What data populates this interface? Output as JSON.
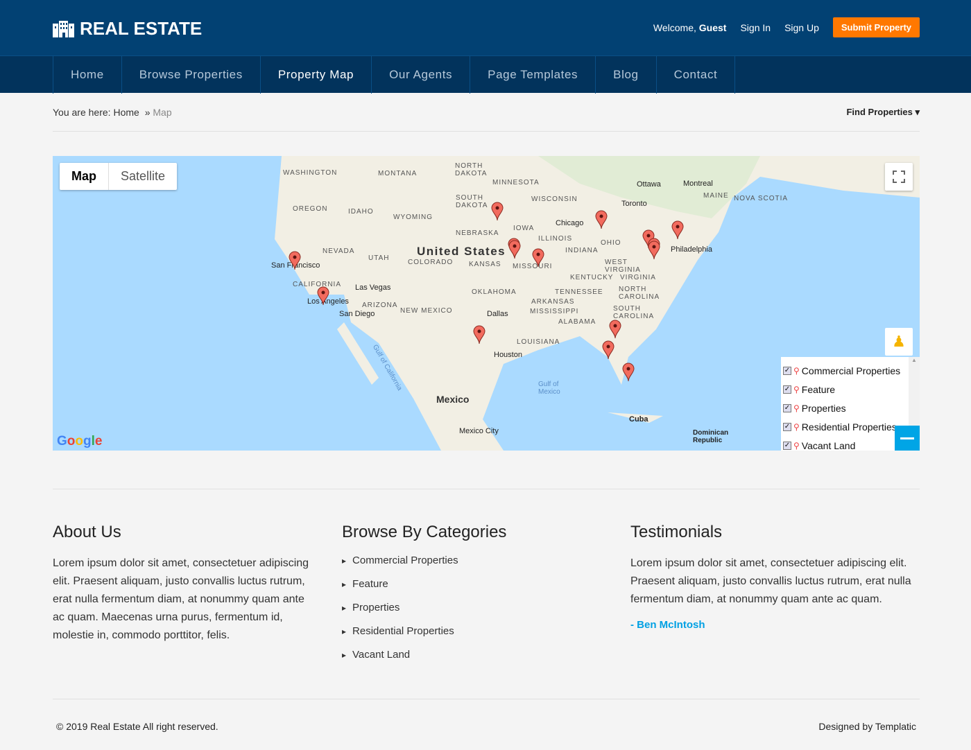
{
  "header": {
    "logo": "REAL ESTATE",
    "welcome": "Welcome,",
    "user": "Guest",
    "sign_in": "Sign In",
    "sign_up": "Sign Up",
    "submit": "Submit Property"
  },
  "nav": [
    "Home",
    "Browse Properties",
    "Property Map",
    "Our Agents",
    "Page Templates",
    "Blog",
    "Contact"
  ],
  "breadcrumb": {
    "prefix": "You are here:",
    "home": "Home",
    "sep": "»",
    "current": "Map",
    "find": "Find Properties"
  },
  "map": {
    "type_map": "Map",
    "type_satellite": "Satellite",
    "country": "United States",
    "mexico": "Mexico",
    "states": [
      "Washington",
      "Montana",
      "North Dakota",
      "Minnesota",
      "South Dakota",
      "Wisconsin",
      "Oregon",
      "Idaho",
      "Wyoming",
      "Nebraska",
      "Iowa",
      "Nevada",
      "Utah",
      "Colorado",
      "Kansas",
      "Missouri",
      "Illinois",
      "Indiana",
      "Ohio",
      "California",
      "Arizona",
      "New Mexico",
      "Oklahoma",
      "Arkansas",
      "Tennessee",
      "Kentucky",
      "Virginia",
      "West Virginia",
      "North Carolina",
      "South Carolina",
      "Mississippi",
      "Alabama",
      "Louisiana",
      "Maine",
      "Nova Scotia"
    ],
    "cities": [
      "San Francisco",
      "Las Vegas",
      "Los Angeles",
      "San Diego",
      "Dallas",
      "Houston",
      "Chicago",
      "Toronto",
      "Ottawa",
      "Montreal",
      "Philadelphia",
      "Cuba",
      "Mexico City",
      "Dominican Republic",
      "Gulf of Mexico",
      "Gulf of California"
    ],
    "google": "Google",
    "legend": [
      "Commercial Properties",
      "Feature",
      "Properties",
      "Residential Properties",
      "Vacant Land"
    ]
  },
  "about": {
    "title": "About Us",
    "text": "Lorem ipsum dolor sit amet, consectetuer adipiscing elit. Praesent aliquam, justo convallis luctus rutrum, erat nulla fermentum diam, at nonummy quam ante ac quam. Maecenas urna purus, fermentum id, molestie in, commodo porttitor, felis."
  },
  "categories": {
    "title": "Browse By Categories",
    "items": [
      "Commercial Properties",
      "Feature",
      "Properties",
      "Residential Properties",
      "Vacant Land"
    ]
  },
  "testimonials": {
    "title": "Testimonials",
    "text": "Lorem ipsum dolor sit amet, consectetuer adipiscing elit. Praesent aliquam, justo convallis luctus rutrum, erat nulla fermentum diam, at nonummy quam ante ac quam.",
    "author": "- Ben McIntosh"
  },
  "footer": {
    "copyright": "© 2019 Real Estate All right reserved.",
    "credit": "Designed by Templatic"
  }
}
